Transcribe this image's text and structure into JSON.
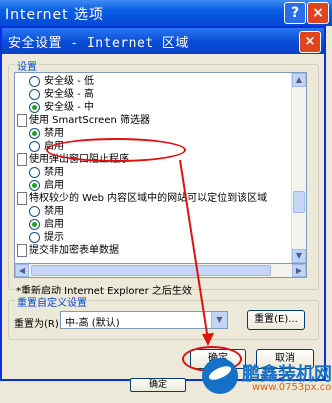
{
  "background_window": {
    "title": "Internet 选项",
    "help_glyph": "?",
    "close_glyph": "×"
  },
  "dialog": {
    "title": "安全设置 - Internet 区域",
    "close_glyph": "×",
    "settings_group_label": "设置",
    "items": [
      {
        "kind": "radio",
        "label": "安全级 - 低",
        "selected": false
      },
      {
        "kind": "radio",
        "label": "安全级 - 高",
        "selected": false
      },
      {
        "kind": "radio",
        "label": "安全级 - 中",
        "selected": true
      },
      {
        "kind": "heading",
        "label": "使用 SmartScreen 筛选器"
      },
      {
        "kind": "radio",
        "label": "禁用",
        "selected": true
      },
      {
        "kind": "radio",
        "label": "启用",
        "selected": false
      },
      {
        "kind": "heading",
        "label": "使用弹出窗口阻止程序"
      },
      {
        "kind": "radio",
        "label": "禁用",
        "selected": false
      },
      {
        "kind": "radio",
        "label": "启用",
        "selected": true
      },
      {
        "kind": "heading",
        "label": "特权较少的 Web 内容区域中的网站可以定位到该区域"
      },
      {
        "kind": "radio",
        "label": "禁用",
        "selected": false
      },
      {
        "kind": "radio",
        "label": "启用",
        "selected": true
      },
      {
        "kind": "radio",
        "label": "提示",
        "selected": false
      },
      {
        "kind": "heading",
        "label": "提交非加密表单数据"
      }
    ],
    "restart_note": "*重新启动 Internet Explorer 之后生效",
    "reset_group_label": "重置自定义设置",
    "reset_to_label": "重置为(R):",
    "reset_select_value": "中-高 (默认)",
    "reset_button": "重置(E)...",
    "ok_button": "确定",
    "cancel_button": "取消",
    "annotation_color": "#e01010"
  },
  "bottom": {
    "button_label": "确定"
  },
  "watermark": {
    "brand": "鹏鑫装机网",
    "url": "www.0753px.com"
  }
}
